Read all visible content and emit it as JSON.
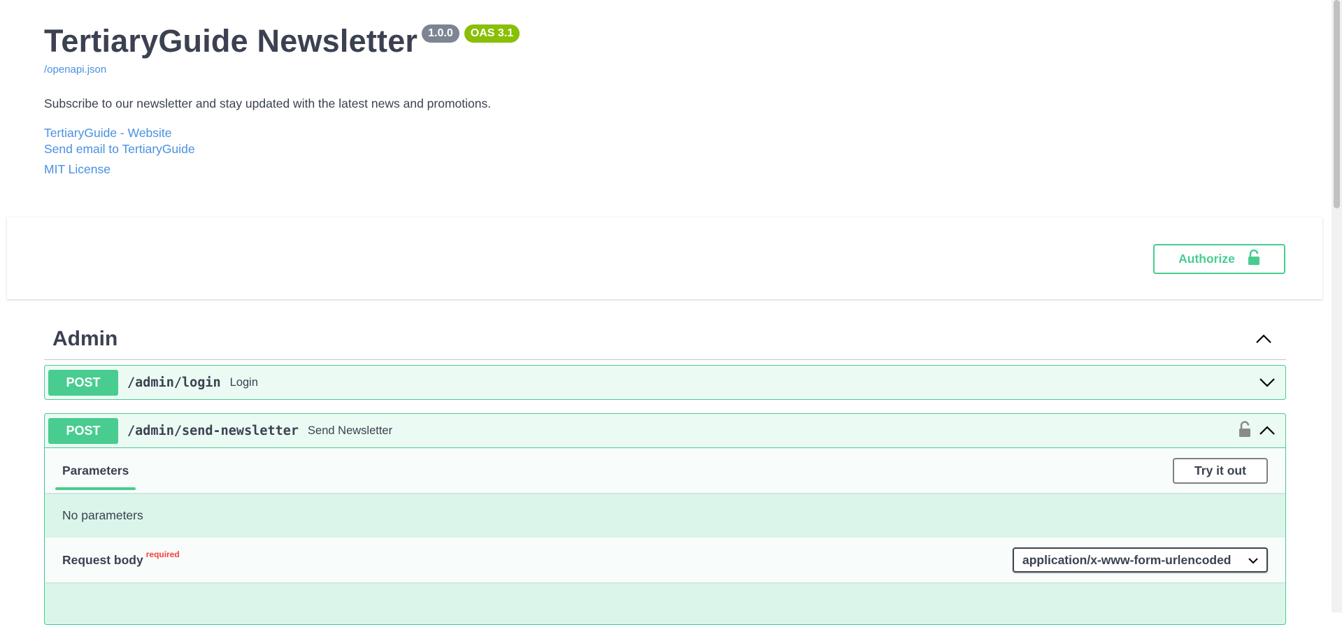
{
  "info": {
    "title": "TertiaryGuide Newsletter",
    "version_badge": "1.0.0",
    "oas_badge": "OAS 3.1",
    "spec_link": "/openapi.json",
    "description": "Subscribe to our newsletter and stay updated with the latest news and promotions.",
    "links": {
      "website": "TertiaryGuide - Website",
      "email": "Send email to TertiaryGuide",
      "license": "MIT License"
    }
  },
  "scheme": {
    "authorize_label": "Authorize",
    "lock_icon": "lock-open-icon"
  },
  "tag": {
    "name": "Admin",
    "toggle_icon": "chevron-up-icon"
  },
  "operations": [
    {
      "method": "POST",
      "path": "/admin/login",
      "summary": "Login",
      "expanded": false
    },
    {
      "method": "POST",
      "path": "/admin/send-newsletter",
      "summary": "Send Newsletter",
      "expanded": true,
      "parameters_tab": "Parameters",
      "try_it_out": "Try it out",
      "no_parameters": "No parameters",
      "request_body_label": "Request body",
      "required_label": "required",
      "content_type": "application/x-www-form-urlencoded"
    }
  ],
  "colors": {
    "post": "#49cc90",
    "text": "#3b4151",
    "link": "#4990e2",
    "version_badge": "#7d8492",
    "oas_badge": "#89bf04",
    "required": "#f93e3e"
  }
}
